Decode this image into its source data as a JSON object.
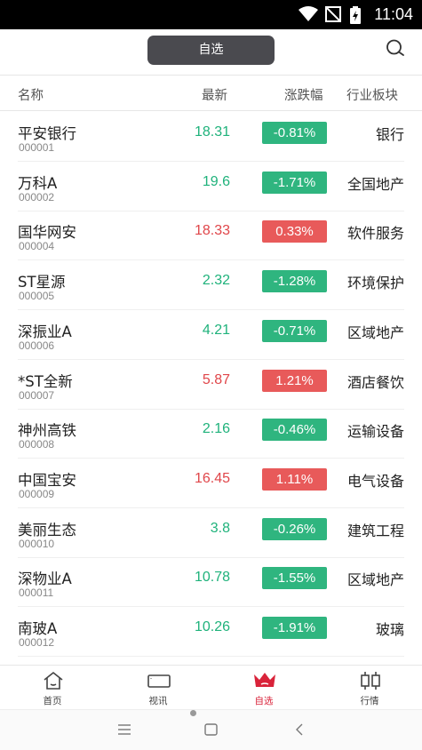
{
  "status_bar": {
    "time": "11:04"
  },
  "header": {
    "title": "自选"
  },
  "columns": {
    "name": "名称",
    "price": "最新",
    "change": "涨跌幅",
    "industry": "行业板块"
  },
  "colors": {
    "up": "#e0464a",
    "down": "#1fb27b",
    "active_tab": "#d9233a"
  },
  "stocks": [
    {
      "name": "平安银行",
      "code": "000001",
      "price": "18.31",
      "change": "-0.81%",
      "industry": "银行",
      "direction": "down"
    },
    {
      "name": "万科A",
      "code": "000002",
      "price": "19.6",
      "change": "-1.71%",
      "industry": "全国地产",
      "direction": "down"
    },
    {
      "name": "国华网安",
      "code": "000004",
      "price": "18.33",
      "change": "0.33%",
      "industry": "软件服务",
      "direction": "up"
    },
    {
      "name": "ST星源",
      "code": "000005",
      "price": "2.32",
      "change": "-1.28%",
      "industry": "环境保护",
      "direction": "down"
    },
    {
      "name": "深振业A",
      "code": "000006",
      "price": "4.21",
      "change": "-0.71%",
      "industry": "区域地产",
      "direction": "down"
    },
    {
      "name": "*ST全新",
      "code": "000007",
      "price": "5.87",
      "change": "1.21%",
      "industry": "酒店餐饮",
      "direction": "up"
    },
    {
      "name": "神州高铁",
      "code": "000008",
      "price": "2.16",
      "change": "-0.46%",
      "industry": "运输设备",
      "direction": "down"
    },
    {
      "name": "中国宝安",
      "code": "000009",
      "price": "16.45",
      "change": "1.11%",
      "industry": "电气设备",
      "direction": "up"
    },
    {
      "name": "美丽生态",
      "code": "000010",
      "price": "3.8",
      "change": "-0.26%",
      "industry": "建筑工程",
      "direction": "down"
    },
    {
      "name": "深物业A",
      "code": "000011",
      "price": "10.78",
      "change": "-1.55%",
      "industry": "区域地产",
      "direction": "down"
    },
    {
      "name": "南玻A",
      "code": "000012",
      "price": "10.26",
      "change": "-1.91%",
      "industry": "玻璃",
      "direction": "down"
    }
  ],
  "tabs": [
    {
      "label": "首页",
      "icon": "home-icon"
    },
    {
      "label": "视讯",
      "icon": "video-icon"
    },
    {
      "label": "自选",
      "icon": "crown-icon",
      "active": true
    },
    {
      "label": "行情",
      "icon": "candlestick-icon"
    }
  ]
}
